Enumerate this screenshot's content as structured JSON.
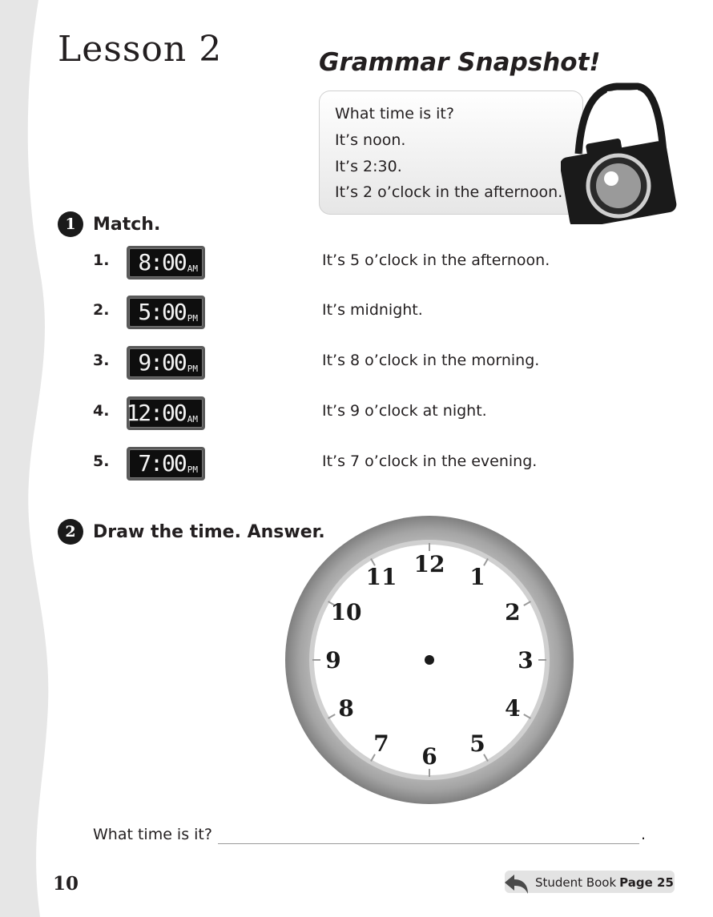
{
  "lesson_title": "Lesson 2",
  "grammar_snapshot": {
    "title": "Grammar Snapshot!",
    "lines": [
      "What time is it?",
      "It’s noon.",
      "It’s 2:30.",
      "It’s 2 o’clock in the afternoon."
    ]
  },
  "section1": {
    "number": "1",
    "title": "Match.",
    "items": [
      {
        "num": "1.",
        "time": "8:00",
        "ampm": "AM",
        "phrase": "It’s 5 o’clock in the afternoon."
      },
      {
        "num": "2.",
        "time": "5:00",
        "ampm": "PM",
        "phrase": "It’s midnight."
      },
      {
        "num": "3.",
        "time": "9:00",
        "ampm": "PM",
        "phrase": "It’s 8 o’clock in the morning."
      },
      {
        "num": "4.",
        "time": "12:00",
        "ampm": "AM",
        "phrase": "It’s 9 o’clock at night."
      },
      {
        "num": "5.",
        "time": "7:00",
        "ampm": "PM",
        "phrase": "It’s 7 o’clock in the evening."
      }
    ]
  },
  "section2": {
    "number": "2",
    "title": "Draw the time. Answer.",
    "clock_numbers": [
      "12",
      "1",
      "2",
      "3",
      "4",
      "5",
      "6",
      "7",
      "8",
      "9",
      "10",
      "11"
    ],
    "question": "What time is it?",
    "end_mark": "."
  },
  "footer": {
    "page_number": "10",
    "book_label": "Student Book",
    "book_page": "Page 25"
  },
  "colors": {
    "side_strip": "#e6e6e6",
    "clock_rim": "#9c9c9c",
    "badge": "#1a1a1a",
    "lcd_screen": "#0e0e0e"
  }
}
